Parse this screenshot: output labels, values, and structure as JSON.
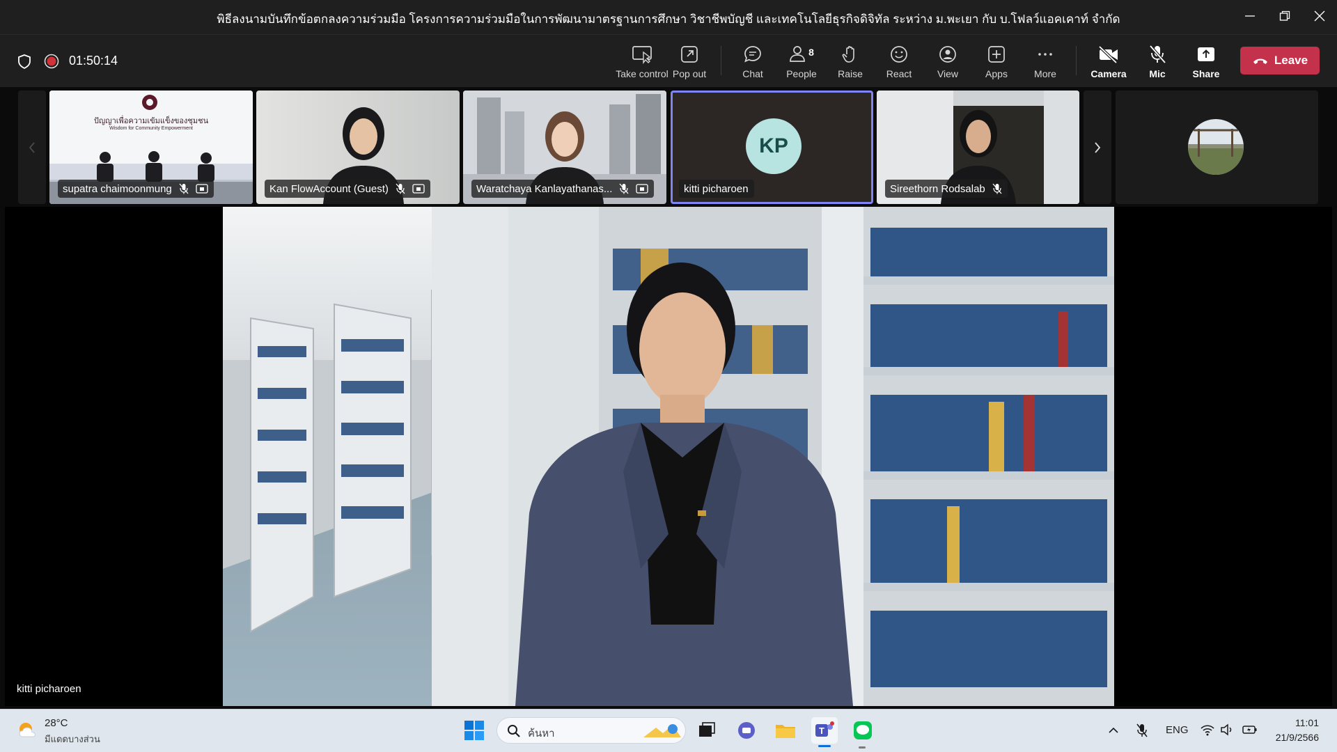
{
  "window": {
    "title": "พิธีลงนามบันทึกข้อตกลงความร่วมมือ โครงการความร่วมมือในการพัฒนามาตรฐานการศึกษา วิชาชีพบัญชี และเทคโนโลยีธุรกิจดิจิทัล ระหว่าง ม.พะเยา กับ บ.โฟลว์แอคเคาท์ จำกัด"
  },
  "meeting": {
    "elapsed": "01:50:14"
  },
  "toolbar": {
    "take_control": "Take control",
    "pop_out": "Pop out",
    "chat": "Chat",
    "people": "People",
    "people_count": "8",
    "raise": "Raise",
    "react": "React",
    "view": "View",
    "apps": "Apps",
    "more": "More",
    "camera": "Camera",
    "mic": "Mic",
    "share": "Share",
    "leave": "Leave"
  },
  "participants": [
    {
      "name": "supatra chaimoonmung",
      "banner_line1": "ปัญญาเพื่อความเข้มแข็งของชุมชน",
      "banner_line2": "Wisdom for Community Empowerment"
    },
    {
      "name": "Kan FlowAccount (Guest)"
    },
    {
      "name": "Waratchaya Kanlayathanas..."
    },
    {
      "name": "kitti picharoen",
      "initials": "KP"
    },
    {
      "name": "Sireethorn Rodsalab"
    }
  ],
  "main_speaker": {
    "name": "kitti picharoen"
  },
  "taskbar": {
    "weather_temp": "28°C",
    "weather_desc": "มีแดดบางส่วน",
    "search_placeholder": "ค้นหา",
    "lang": "ENG",
    "time": "11:01",
    "date": "21/9/2566"
  },
  "colors": {
    "accent": "#7f85f5",
    "leave": "#c4314b",
    "titlebar": "#1f1f1f",
    "avatar_bg": "#b7e3e0"
  }
}
